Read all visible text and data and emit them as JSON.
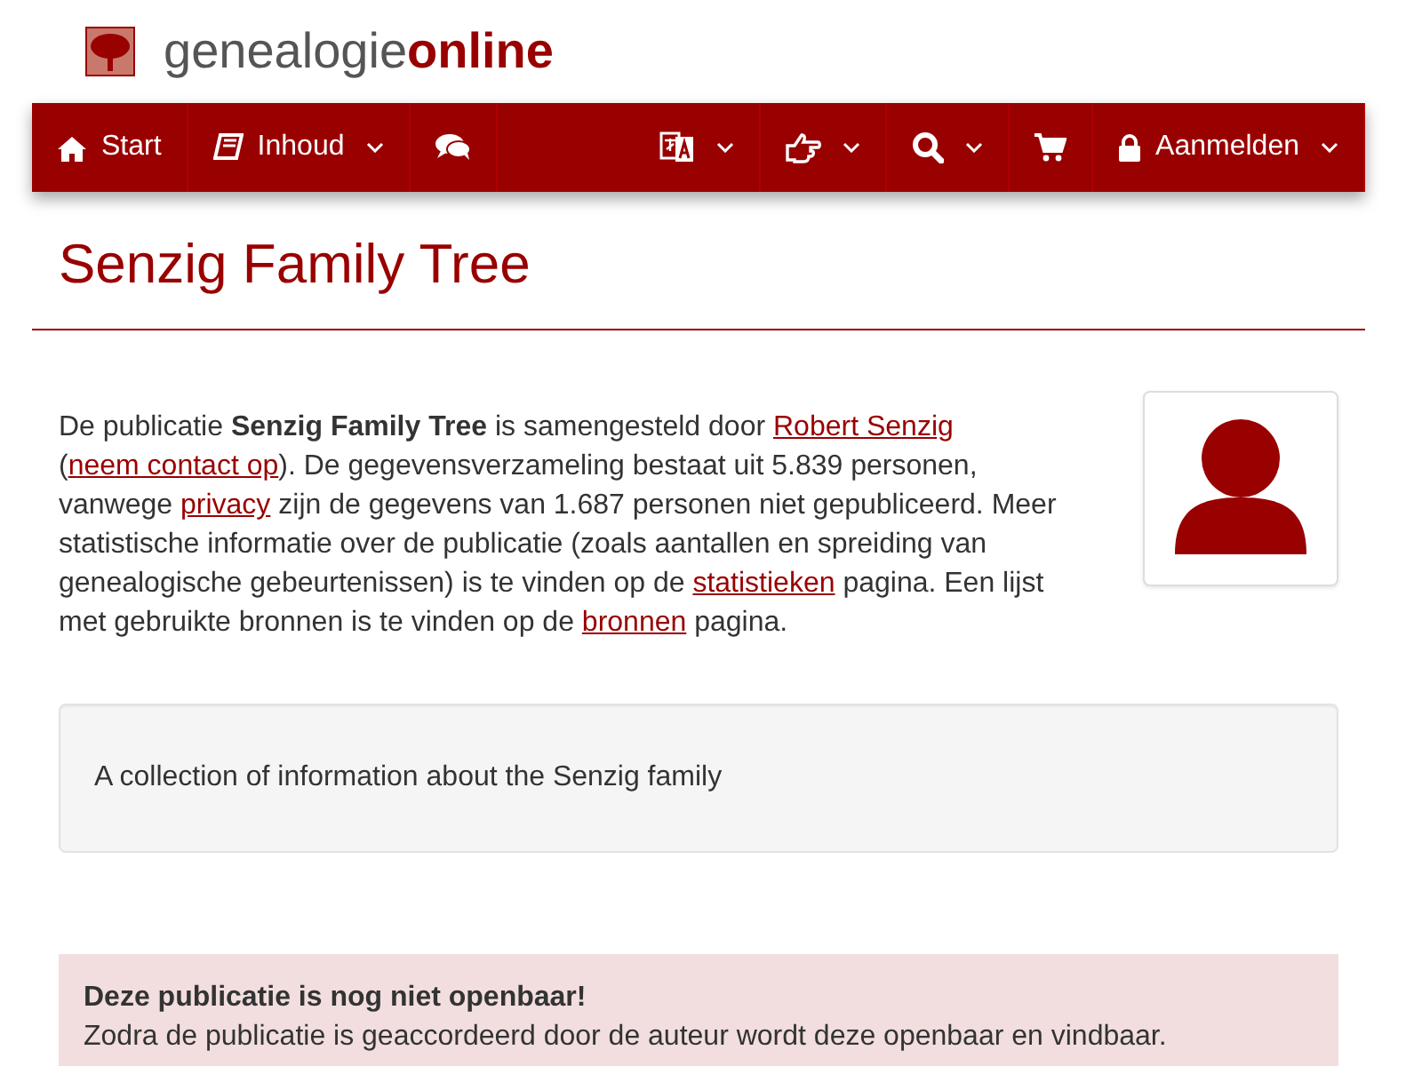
{
  "brand": {
    "part_1": "genealogie",
    "part_2": "online"
  },
  "nav": [
    {
      "kind": "link",
      "text": "Start",
      "dropdown": false
    },
    {
      "kind": "link",
      "text": "Inhoud",
      "dropdown": true
    },
    {
      "kind": "link",
      "dropdown": false
    },
    {
      "kind": "spacer"
    },
    {
      "kind": "link",
      "dropdown": true
    },
    {
      "kind": "link",
      "dropdown": true
    },
    {
      "kind": "link",
      "dropdown": true
    },
    {
      "kind": "link",
      "dropdown": false
    },
    {
      "kind": "link",
      "text": "Aanmelden",
      "dropdown": true
    }
  ],
  "title": "Senzig Family Tree",
  "intro": [
    {
      "kind": "text",
      "text": "De publicatie **Senzig Family Tree** is samengesteld door "
    },
    {
      "kind": "link",
      "text": "Robert Senzig"
    },
    {
      "kind": "text",
      "text": " ("
    },
    {
      "kind": "link",
      "text": "neem contact op"
    },
    {
      "kind": "text",
      "text": "). De gegevensverzameling bestaat uit 5.839 personen, vanwege "
    },
    {
      "kind": "link",
      "text": "privacy"
    },
    {
      "kind": "text",
      "text": " zijn de gegevens van 1.687 personen niet gepubliceerd. Meer statistische informatie over de publicatie (zoals aantallen en spreiding van genealogische gebeurtenissen) is te vinden op de "
    },
    {
      "kind": "link",
      "text": "statistieken"
    },
    {
      "kind": "text",
      "text": " pagina. Een lijst met gebruikte bronnen is te vinden op de "
    },
    {
      "kind": "link",
      "text": "bronnen"
    },
    {
      "kind": "text",
      "text": " pagina."
    }
  ],
  "description": "A collection of information about the Senzig family",
  "alert": {
    "heading": "Deze publicatie is nog niet openbaar!",
    "text": "Zodra de publicatie is geaccordeerd door de auteur wordt deze openbaar en vindbaar."
  }
}
